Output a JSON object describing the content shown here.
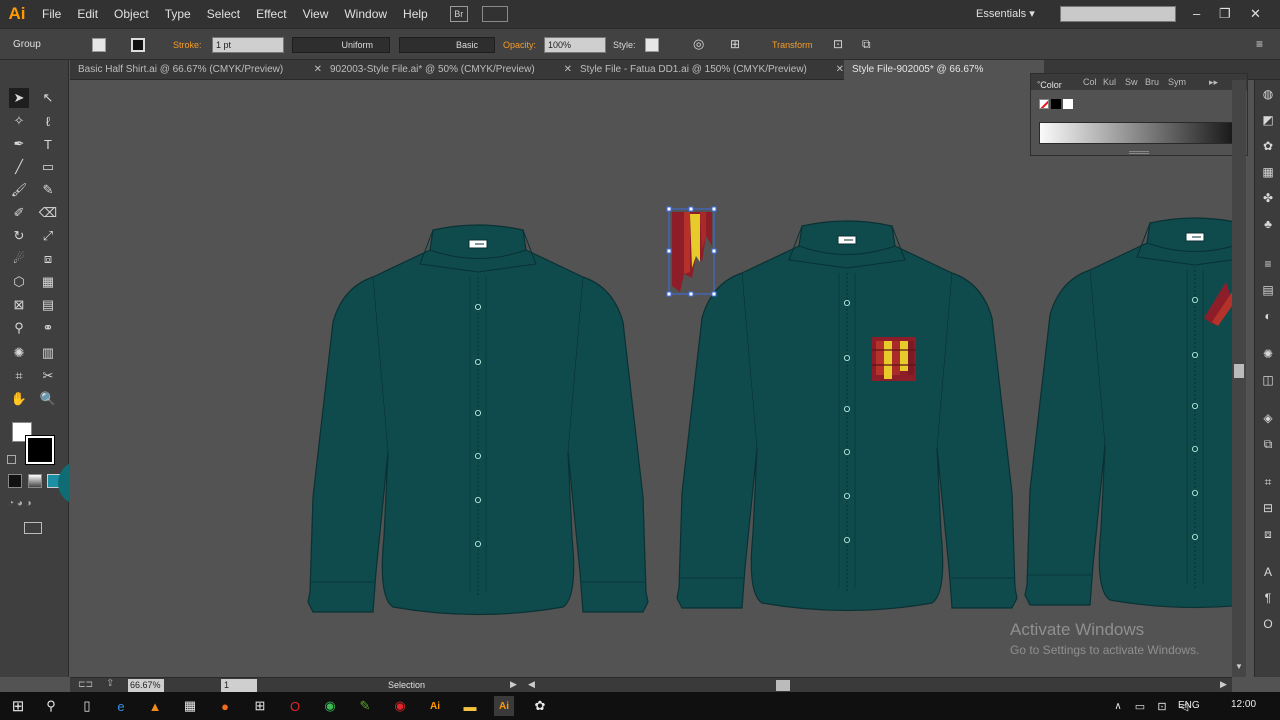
{
  "app": {
    "logo": "Ai"
  },
  "menu": [
    "File",
    "Edit",
    "Object",
    "Type",
    "Select",
    "Effect",
    "View",
    "Window",
    "Help"
  ],
  "bridge_label": "Br",
  "workspace": "Essentials",
  "control": {
    "selection_type": "Group",
    "stroke_label": "Stroke:",
    "stroke_value": "1 pt",
    "profile": "Uniform",
    "brush": "Basic",
    "opacity_label": "Opacity:",
    "opacity_value": "100%",
    "style_label": "Style:",
    "transform_label": "Transform"
  },
  "tabs": [
    {
      "label": "Basic Half Shirt.ai @ 66.67% (CMYK/Preview)",
      "active": false
    },
    {
      "label": "902003-Style File.ai* @ 50% (CMYK/Preview)",
      "active": false
    },
    {
      "label": "Style File - Fatua DD1.ai @ 150% (CMYK/Preview)",
      "active": false
    },
    {
      "label": "Style File-902005* @ 66.67% (CMYK/Preview)",
      "active": true
    }
  ],
  "color_panel": {
    "tabs": [
      "Color",
      "Col",
      "Kul",
      "Sw",
      "Bru",
      "Sym"
    ]
  },
  "status": {
    "zoom": "66.67%",
    "page": "1",
    "tool": "Selection"
  },
  "watermark": {
    "line1": "Activate Windows",
    "line2": "Go to Settings to activate Windows."
  },
  "taskbar": {
    "lang": "ENG",
    "time": "12:00"
  },
  "colors": {
    "shirt_fill": "#0f4b4d",
    "shirt_stroke": "#0a3133",
    "accent_red": "#8e1d2a",
    "accent_yellow": "#e7cb2b",
    "selection_blue": "#3c6fe0",
    "ai_orange": "#ff9a00"
  }
}
